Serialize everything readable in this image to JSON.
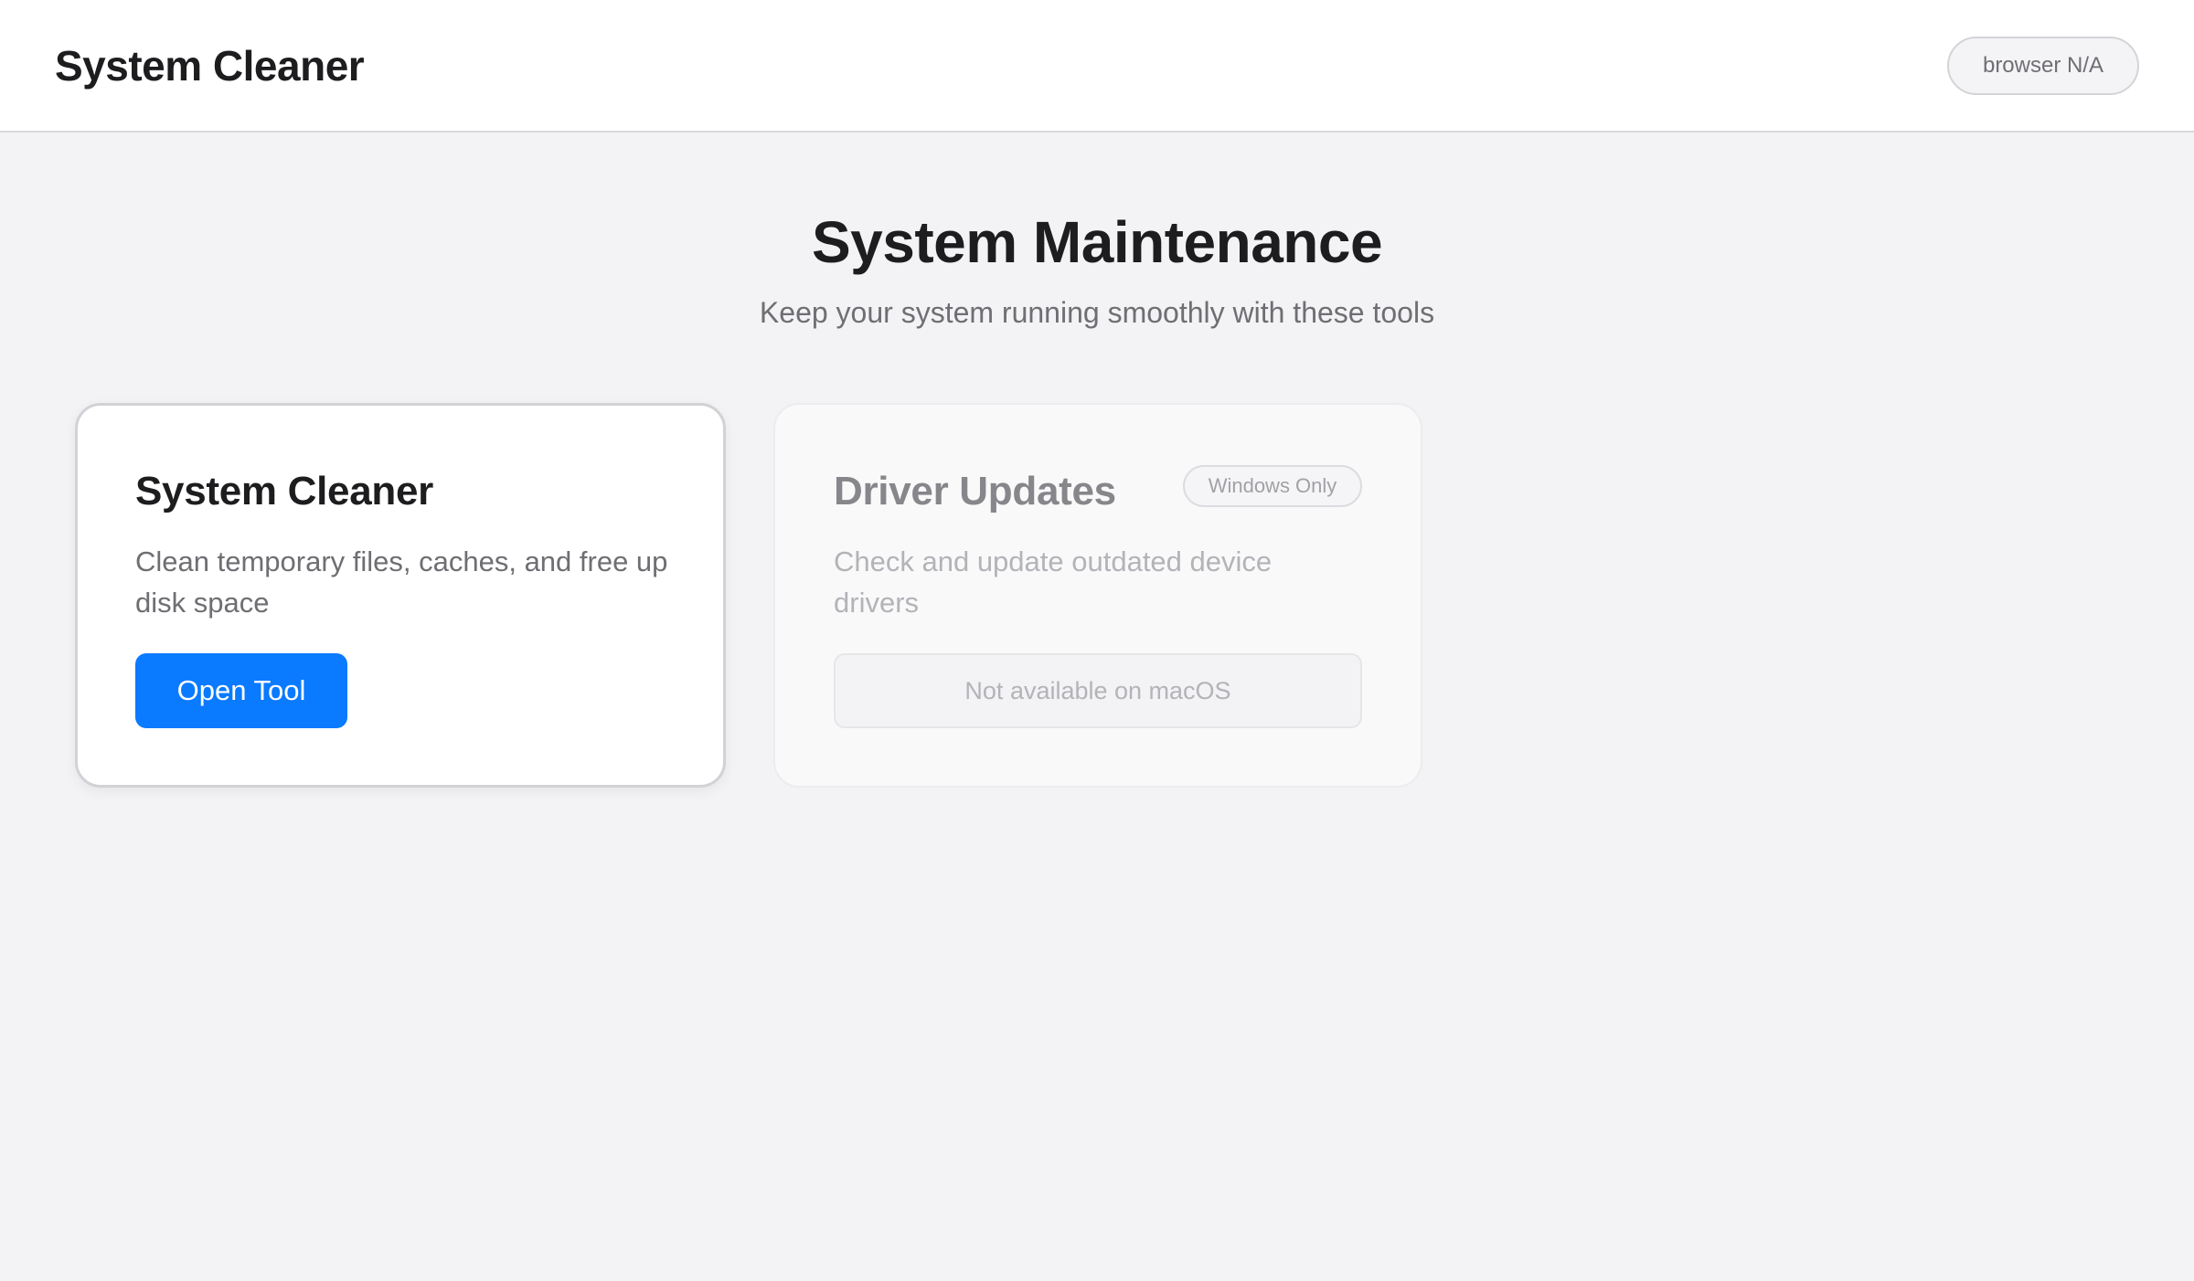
{
  "header": {
    "title": "System Cleaner",
    "platform_badge": "browser N/A"
  },
  "hero": {
    "title": "System Maintenance",
    "subtitle": "Keep your system running smoothly with these tools"
  },
  "cards": [
    {
      "title": "System Cleaner",
      "description": "Clean temporary files, caches, and free up disk space",
      "action_label": "Open Tool",
      "enabled": true
    },
    {
      "title": "Driver Updates",
      "tag": "Windows Only",
      "description": "Check and update outdated device drivers",
      "action_label": "Not available on macOS",
      "enabled": false
    }
  ],
  "colors": {
    "accent": "#0a7aff",
    "background": "#f3f3f5",
    "text_primary": "#1d1d1f",
    "text_secondary": "#6e6e73"
  }
}
